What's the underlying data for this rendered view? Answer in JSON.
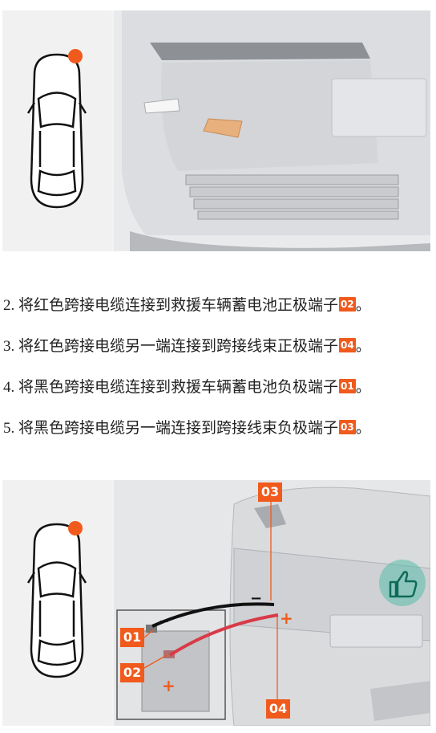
{
  "steps": [
    {
      "number": "2.",
      "text": "将红色跨接电缆连接到救援车辆蓄电池正极端子",
      "badge": "02",
      "end": "。"
    },
    {
      "number": "3.",
      "text": "将红色跨接电缆另一端连接到跨接线束正极端子",
      "badge": "04",
      "end": "。"
    },
    {
      "number": "4.",
      "text": "将黑色跨接电缆连接到救援车辆蓄电池负极端子",
      "badge": "01",
      "end": "。"
    },
    {
      "number": "5.",
      "text": "将黑色跨接电缆另一端连接到跨接线束负极端子",
      "badge": "03",
      "end": "。"
    }
  ],
  "diagram": {
    "callouts": [
      "03",
      "01",
      "02",
      "04"
    ],
    "minus_sign": "−",
    "plus_sign": "+"
  },
  "colors": {
    "accent": "#f05a1c",
    "panel": "#f3f3f3",
    "cable_red": "#d83a48",
    "cable_black": "#111111"
  },
  "icons": {
    "car_top_view": "car-top-view-icon",
    "location_marker": "location-dot-icon",
    "like": "thumbs-up-icon"
  }
}
